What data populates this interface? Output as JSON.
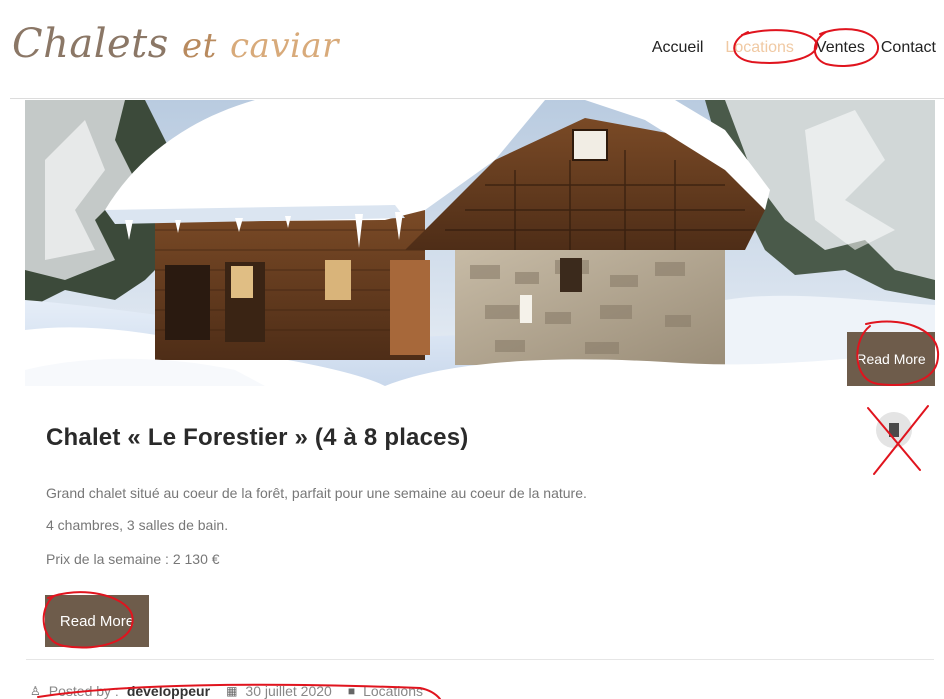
{
  "header": {
    "logo": {
      "word1": "Chalets",
      "word2": "et",
      "word3": "caviar"
    },
    "nav": [
      {
        "label": "Accueil"
      },
      {
        "label": "Locations"
      },
      {
        "label": "Ventes"
      },
      {
        "label": "Contact"
      }
    ]
  },
  "hero": {
    "read_more_label": "Read More"
  },
  "post": {
    "title": "Chalet « Le Forestier » (4 à 8 places)",
    "lines": [
      "Grand chalet situé au coeur de la forêt, parfait pour une semaine au coeur de la nature.",
      "4 chambres, 3 salles de bain.",
      "Prix de la semaine : 2 130 €"
    ],
    "read_more_label": "Read More",
    "format_icon": "document-icon"
  },
  "meta": {
    "posted_by_label": "Posted by :",
    "author": "developpeur",
    "date": "30 juillet 2020",
    "category": "Locations"
  },
  "colors": {
    "accent_brown": "#6e5c4b",
    "active_nav": "#f0c9a3",
    "annotation_red": "#e0141e"
  }
}
